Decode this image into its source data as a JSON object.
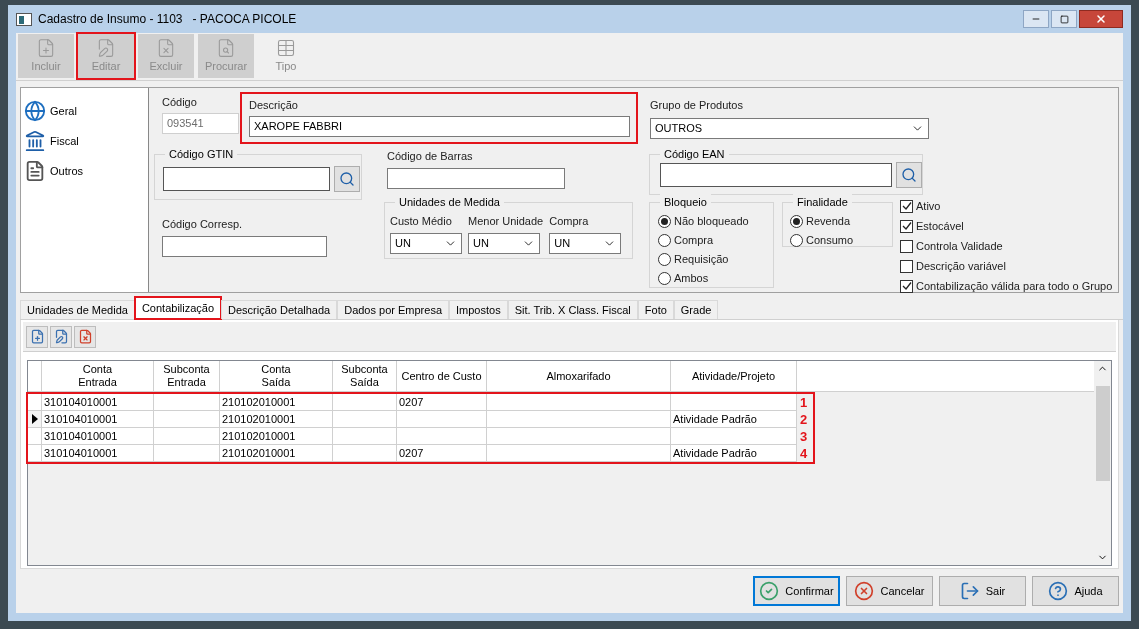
{
  "window": {
    "title": "Cadastro de Insumo - 1103   - PACOCA PICOLE"
  },
  "toolbar": [
    {
      "label": "Incluir",
      "kind": "add",
      "highlighted": false
    },
    {
      "label": "Editar",
      "kind": "edit",
      "highlighted": true
    },
    {
      "label": "Excluir",
      "kind": "delete",
      "highlighted": false
    },
    {
      "label": "Procurar",
      "kind": "search",
      "highlighted": false
    },
    {
      "label": "Tipo",
      "kind": "type",
      "highlighted": false
    }
  ],
  "nav": [
    {
      "label": "Geral",
      "kind": "globe"
    },
    {
      "label": "Fiscal",
      "kind": "bank"
    },
    {
      "label": "Outros",
      "kind": "doc"
    }
  ],
  "codigo": {
    "label": "Código",
    "value": "093541",
    "disabled": true
  },
  "descricao": {
    "label": "Descrição",
    "value": "XAROPE FABBRI",
    "highlighted": true
  },
  "grupo": {
    "label": "Grupo de Produtos",
    "value": "OUTROS"
  },
  "gtin": {
    "label": "Código GTIN"
  },
  "barras": {
    "label": "Código de Barras"
  },
  "corresp": {
    "label": "Código Corresp."
  },
  "ean": {
    "label": "Código EAN"
  },
  "unidades": {
    "title": "Unidades de Medida",
    "fields": [
      {
        "label": "Custo Médio",
        "value": "UN"
      },
      {
        "label": "Menor Unidade",
        "value": "UN"
      },
      {
        "label": "Compra",
        "value": "UN"
      }
    ]
  },
  "bloqueio": {
    "title": "Bloqueio",
    "options": [
      {
        "label": "Não bloqueado",
        "selected": true
      },
      {
        "label": "Compra",
        "selected": false
      },
      {
        "label": "Requisição",
        "selected": false
      },
      {
        "label": "Ambos",
        "selected": false
      }
    ]
  },
  "finalidade": {
    "title": "Finalidade",
    "options": [
      {
        "label": "Revenda",
        "selected": true
      },
      {
        "label": "Consumo",
        "selected": false
      }
    ]
  },
  "checks": [
    {
      "label": "Ativo",
      "checked": true
    },
    {
      "label": "Estocável",
      "checked": true
    },
    {
      "label": "Controla Validade",
      "checked": false
    },
    {
      "label": "Descrição variável",
      "checked": false
    },
    {
      "label": "Contabilização válida para todo o Grupo",
      "checked": true
    }
  ],
  "tabs": [
    {
      "label": "Unidades de Medida",
      "selected": false,
      "highlighted": false
    },
    {
      "label": "Contabilização",
      "selected": true,
      "highlighted": true
    },
    {
      "label": "Descrição Detalhada",
      "selected": false,
      "highlighted": false
    },
    {
      "label": "Dados por Empresa",
      "selected": false,
      "highlighted": false
    },
    {
      "label": "Impostos",
      "selected": false,
      "highlighted": false
    },
    {
      "label": "Sit. Trib. X Class. Fiscal",
      "selected": false,
      "highlighted": false
    },
    {
      "label": "Foto",
      "selected": false,
      "highlighted": false
    },
    {
      "label": "Grade",
      "selected": false,
      "highlighted": false
    }
  ],
  "grid": {
    "columns": [
      "Conta\nEntrada",
      "Subconta\nEntrada",
      "Conta\nSaída",
      "Subconta\nSaída",
      "Centro de Custo",
      "Almoxarifado",
      "Atividade/Projeto"
    ],
    "rows_highlighted": true,
    "rows": [
      {
        "cells": [
          "310104010001",
          "",
          "210102010001",
          "",
          "0207",
          "",
          ""
        ],
        "current": false,
        "marker": "1"
      },
      {
        "cells": [
          "310104010001",
          "",
          "210102010001",
          "",
          "",
          "",
          "Atividade Padrão"
        ],
        "current": true,
        "marker": "2"
      },
      {
        "cells": [
          "310104010001",
          "",
          "210102010001",
          "",
          "",
          "",
          ""
        ],
        "current": false,
        "marker": "3"
      },
      {
        "cells": [
          "310104010001",
          "",
          "210102010001",
          "",
          "0207",
          "",
          "Atividade Padrão"
        ],
        "current": false,
        "marker": "4"
      }
    ]
  },
  "buttons": [
    {
      "label": "Confirmar",
      "kind": "ok",
      "focused": true
    },
    {
      "label": "Cancelar",
      "kind": "cancel",
      "focused": false
    },
    {
      "label": "Sair",
      "kind": "exit",
      "focused": false
    },
    {
      "label": "Ajuda",
      "kind": "help",
      "focused": false
    }
  ]
}
